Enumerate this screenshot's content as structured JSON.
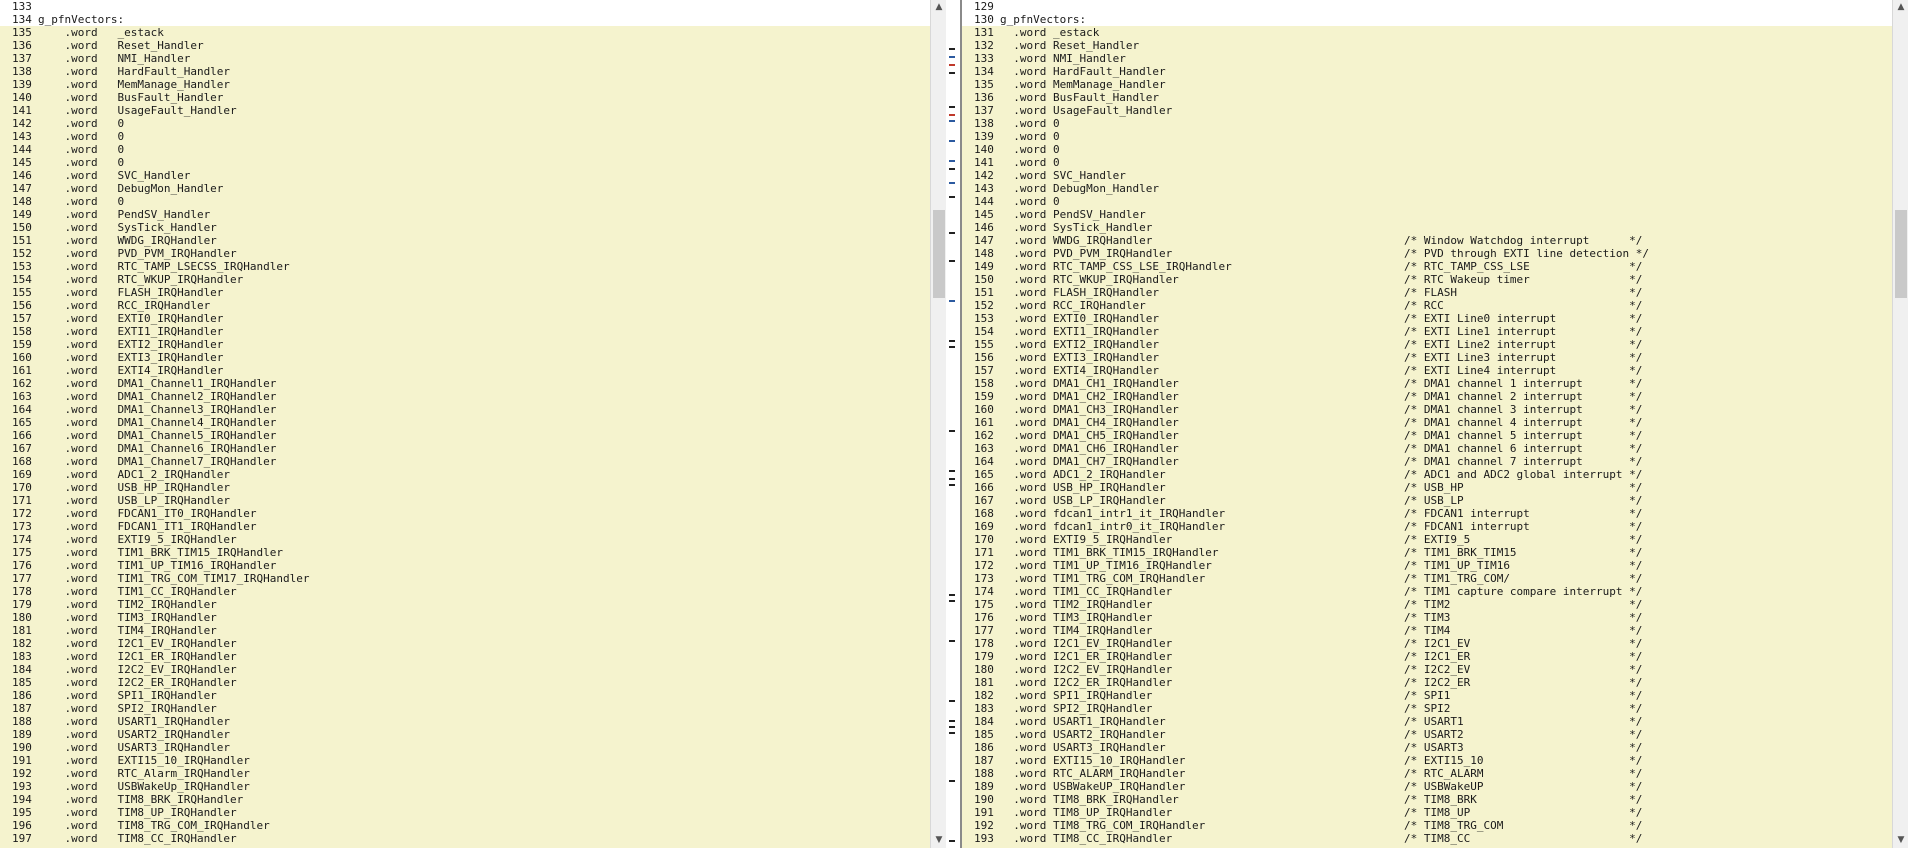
{
  "left": {
    "lines": [
      {
        "n": "133",
        "t": ""
      },
      {
        "n": "134",
        "t": "g_pfnVectors:"
      },
      {
        "n": "135",
        "t": "    .word   _estack"
      },
      {
        "n": "136",
        "t": "    .word   Reset_Handler"
      },
      {
        "n": "137",
        "t": "    .word   NMI_Handler"
      },
      {
        "n": "138",
        "t": "    .word   HardFault_Handler"
      },
      {
        "n": "139",
        "t": "    .word   MemManage_Handler"
      },
      {
        "n": "140",
        "t": "    .word   BusFault_Handler"
      },
      {
        "n": "141",
        "t": "    .word   UsageFault_Handler"
      },
      {
        "n": "142",
        "t": "    .word   0"
      },
      {
        "n": "143",
        "t": "    .word   0"
      },
      {
        "n": "144",
        "t": "    .word   0"
      },
      {
        "n": "145",
        "t": "    .word   0"
      },
      {
        "n": "146",
        "t": "    .word   SVC_Handler"
      },
      {
        "n": "147",
        "t": "    .word   DebugMon_Handler"
      },
      {
        "n": "148",
        "t": "    .word   0"
      },
      {
        "n": "149",
        "t": "    .word   PendSV_Handler"
      },
      {
        "n": "150",
        "t": "    .word   SysTick_Handler"
      },
      {
        "n": "151",
        "t": "    .word   WWDG_IRQHandler"
      },
      {
        "n": "152",
        "t": "    .word   PVD_PVM_IRQHandler"
      },
      {
        "n": "153",
        "t": "    .word   RTC_TAMP_LSECSS_IRQHandler"
      },
      {
        "n": "154",
        "t": "    .word   RTC_WKUP_IRQHandler"
      },
      {
        "n": "155",
        "t": "    .word   FLASH_IRQHandler"
      },
      {
        "n": "156",
        "t": "    .word   RCC_IRQHandler"
      },
      {
        "n": "157",
        "t": "    .word   EXTI0_IRQHandler"
      },
      {
        "n": "158",
        "t": "    .word   EXTI1_IRQHandler"
      },
      {
        "n": "159",
        "t": "    .word   EXTI2_IRQHandler"
      },
      {
        "n": "160",
        "t": "    .word   EXTI3_IRQHandler"
      },
      {
        "n": "161",
        "t": "    .word   EXTI4_IRQHandler"
      },
      {
        "n": "162",
        "t": "    .word   DMA1_Channel1_IRQHandler"
      },
      {
        "n": "163",
        "t": "    .word   DMA1_Channel2_IRQHandler"
      },
      {
        "n": "164",
        "t": "    .word   DMA1_Channel3_IRQHandler"
      },
      {
        "n": "165",
        "t": "    .word   DMA1_Channel4_IRQHandler"
      },
      {
        "n": "166",
        "t": "    .word   DMA1_Channel5_IRQHandler"
      },
      {
        "n": "167",
        "t": "    .word   DMA1_Channel6_IRQHandler"
      },
      {
        "n": "168",
        "t": "    .word   DMA1_Channel7_IRQHandler"
      },
      {
        "n": "169",
        "t": "    .word   ADC1_2_IRQHandler"
      },
      {
        "n": "170",
        "t": "    .word   USB_HP_IRQHandler"
      },
      {
        "n": "171",
        "t": "    .word   USB_LP_IRQHandler"
      },
      {
        "n": "172",
        "t": "    .word   FDCAN1_IT0_IRQHandler"
      },
      {
        "n": "173",
        "t": "    .word   FDCAN1_IT1_IRQHandler"
      },
      {
        "n": "174",
        "t": "    .word   EXTI9_5_IRQHandler"
      },
      {
        "n": "175",
        "t": "    .word   TIM1_BRK_TIM15_IRQHandler"
      },
      {
        "n": "176",
        "t": "    .word   TIM1_UP_TIM16_IRQHandler"
      },
      {
        "n": "177",
        "t": "    .word   TIM1_TRG_COM_TIM17_IRQHandler"
      },
      {
        "n": "178",
        "t": "    .word   TIM1_CC_IRQHandler"
      },
      {
        "n": "179",
        "t": "    .word   TIM2_IRQHandler"
      },
      {
        "n": "180",
        "t": "    .word   TIM3_IRQHandler"
      },
      {
        "n": "181",
        "t": "    .word   TIM4_IRQHandler"
      },
      {
        "n": "182",
        "t": "    .word   I2C1_EV_IRQHandler"
      },
      {
        "n": "183",
        "t": "    .word   I2C1_ER_IRQHandler"
      },
      {
        "n": "184",
        "t": "    .word   I2C2_EV_IRQHandler"
      },
      {
        "n": "185",
        "t": "    .word   I2C2_ER_IRQHandler"
      },
      {
        "n": "186",
        "t": "    .word   SPI1_IRQHandler"
      },
      {
        "n": "187",
        "t": "    .word   SPI2_IRQHandler"
      },
      {
        "n": "188",
        "t": "    .word   USART1_IRQHandler"
      },
      {
        "n": "189",
        "t": "    .word   USART2_IRQHandler"
      },
      {
        "n": "190",
        "t": "    .word   USART3_IRQHandler"
      },
      {
        "n": "191",
        "t": "    .word   EXTI15_10_IRQHandler"
      },
      {
        "n": "192",
        "t": "    .word   RTC_Alarm_IRQHandler"
      },
      {
        "n": "193",
        "t": "    .word   USBWakeUp_IRQHandler"
      },
      {
        "n": "194",
        "t": "    .word   TIM8_BRK_IRQHandler"
      },
      {
        "n": "195",
        "t": "    .word   TIM8_UP_IRQHandler"
      },
      {
        "n": "196",
        "t": "    .word   TIM8_TRG_COM_IRQHandler"
      },
      {
        "n": "197",
        "t": "    .word   TIM8_CC_IRQHandler"
      }
    ]
  },
  "right": {
    "lines": [
      {
        "n": "129",
        "t": ""
      },
      {
        "n": "130",
        "t": "g_pfnVectors:"
      },
      {
        "n": "131",
        "t": "  .word _estack"
      },
      {
        "n": "132",
        "t": "  .word Reset_Handler"
      },
      {
        "n": "133",
        "t": "  .word NMI_Handler"
      },
      {
        "n": "134",
        "t": "  .word HardFault_Handler"
      },
      {
        "n": "135",
        "t": "  .word MemManage_Handler"
      },
      {
        "n": "136",
        "t": "  .word BusFault_Handler"
      },
      {
        "n": "137",
        "t": "  .word UsageFault_Handler"
      },
      {
        "n": "138",
        "t": "  .word 0"
      },
      {
        "n": "139",
        "t": "  .word 0"
      },
      {
        "n": "140",
        "t": "  .word 0"
      },
      {
        "n": "141",
        "t": "  .word 0"
      },
      {
        "n": "142",
        "t": "  .word SVC_Handler"
      },
      {
        "n": "143",
        "t": "  .word DebugMon_Handler"
      },
      {
        "n": "144",
        "t": "  .word 0"
      },
      {
        "n": "145",
        "t": "  .word PendSV_Handler"
      },
      {
        "n": "146",
        "t": "  .word SysTick_Handler"
      },
      {
        "n": "147",
        "t": "  .word WWDG_IRQHandler                                      /* Window Watchdog interrupt      */"
      },
      {
        "n": "148",
        "t": "  .word PVD_PVM_IRQHandler                                   /* PVD through EXTI line detection */"
      },
      {
        "n": "149",
        "t": "  .word RTC_TAMP_CSS_LSE_IRQHandler                          /* RTC_TAMP_CSS_LSE               */"
      },
      {
        "n": "150",
        "t": "  .word RTC_WKUP_IRQHandler                                  /* RTC Wakeup timer               */"
      },
      {
        "n": "151",
        "t": "  .word FLASH_IRQHandler                                     /* FLASH                          */"
      },
      {
        "n": "152",
        "t": "  .word RCC_IRQHandler                                       /* RCC                            */"
      },
      {
        "n": "153",
        "t": "  .word EXTI0_IRQHandler                                     /* EXTI Line0 interrupt           */"
      },
      {
        "n": "154",
        "t": "  .word EXTI1_IRQHandler                                     /* EXTI Line1 interrupt           */"
      },
      {
        "n": "155",
        "t": "  .word EXTI2_IRQHandler                                     /* EXTI Line2 interrupt           */"
      },
      {
        "n": "156",
        "t": "  .word EXTI3_IRQHandler                                     /* EXTI Line3 interrupt           */"
      },
      {
        "n": "157",
        "t": "  .word EXTI4_IRQHandler                                     /* EXTI Line4 interrupt           */"
      },
      {
        "n": "158",
        "t": "  .word DMA1_CH1_IRQHandler                                  /* DMA1 channel 1 interrupt       */"
      },
      {
        "n": "159",
        "t": "  .word DMA1_CH2_IRQHandler                                  /* DMA1 channel 2 interrupt       */"
      },
      {
        "n": "160",
        "t": "  .word DMA1_CH3_IRQHandler                                  /* DMA1 channel 3 interrupt       */"
      },
      {
        "n": "161",
        "t": "  .word DMA1_CH4_IRQHandler                                  /* DMA1 channel 4 interrupt       */"
      },
      {
        "n": "162",
        "t": "  .word DMA1_CH5_IRQHandler                                  /* DMA1 channel 5 interrupt       */"
      },
      {
        "n": "163",
        "t": "  .word DMA1_CH6_IRQHandler                                  /* DMA1 channel 6 interrupt       */"
      },
      {
        "n": "164",
        "t": "  .word DMA1_CH7_IRQHandler                                  /* DMA1 channel 7 interrupt       */"
      },
      {
        "n": "165",
        "t": "  .word ADC1_2_IRQHandler                                    /* ADC1 and ADC2 global interrupt */"
      },
      {
        "n": "166",
        "t": "  .word USB_HP_IRQHandler                                    /* USB_HP                         */"
      },
      {
        "n": "167",
        "t": "  .word USB_LP_IRQHandler                                    /* USB_LP                         */"
      },
      {
        "n": "168",
        "t": "  .word fdcan1_intr1_it_IRQHandler                           /* FDCAN1 interrupt               */"
      },
      {
        "n": "169",
        "t": "  .word fdcan1_intr0_it_IRQHandler                           /* FDCAN1 interrupt               */"
      },
      {
        "n": "170",
        "t": "  .word EXTI9_5_IRQHandler                                   /* EXTI9_5                        */"
      },
      {
        "n": "171",
        "t": "  .word TIM1_BRK_TIM15_IRQHandler                            /* TIM1_BRK_TIM15                 */"
      },
      {
        "n": "172",
        "t": "  .word TIM1_UP_TIM16_IRQHandler                             /* TIM1_UP_TIM16                  */"
      },
      {
        "n": "173",
        "t": "  .word TIM1_TRG_COM_IRQHandler                              /* TIM1_TRG_COM/                  */"
      },
      {
        "n": "174",
        "t": "  .word TIM1_CC_IRQHandler                                   /* TIM1 capture compare interrupt */"
      },
      {
        "n": "175",
        "t": "  .word TIM2_IRQHandler                                      /* TIM2                           */"
      },
      {
        "n": "176",
        "t": "  .word TIM3_IRQHandler                                      /* TIM3                           */"
      },
      {
        "n": "177",
        "t": "  .word TIM4_IRQHandler                                      /* TIM4                           */"
      },
      {
        "n": "178",
        "t": "  .word I2C1_EV_IRQHandler                                   /* I2C1_EV                        */"
      },
      {
        "n": "179",
        "t": "  .word I2C1_ER_IRQHandler                                   /* I2C1_ER                        */"
      },
      {
        "n": "180",
        "t": "  .word I2C2_EV_IRQHandler                                   /* I2C2_EV                        */"
      },
      {
        "n": "181",
        "t": "  .word I2C2_ER_IRQHandler                                   /* I2C2_ER                        */"
      },
      {
        "n": "182",
        "t": "  .word SPI1_IRQHandler                                      /* SPI1                           */"
      },
      {
        "n": "183",
        "t": "  .word SPI2_IRQHandler                                      /* SPI2                           */"
      },
      {
        "n": "184",
        "t": "  .word USART1_IRQHandler                                    /* USART1                         */"
      },
      {
        "n": "185",
        "t": "  .word USART2_IRQHandler                                    /* USART2                         */"
      },
      {
        "n": "186",
        "t": "  .word USART3_IRQHandler                                    /* USART3                         */"
      },
      {
        "n": "187",
        "t": "  .word EXTI15_10_IRQHandler                                 /* EXTI15_10                      */"
      },
      {
        "n": "188",
        "t": "  .word RTC_ALARM_IRQHandler                                 /* RTC_ALARM                      */"
      },
      {
        "n": "189",
        "t": "  .word USBWakeUP_IRQHandler                                 /* USBWakeUP                      */"
      },
      {
        "n": "190",
        "t": "  .word TIM8_BRK_IRQHandler                                  /* TIM8_BRK                       */"
      },
      {
        "n": "191",
        "t": "  .word TIM8_UP_IRQHandler                                   /* TIM8_UP                        */"
      },
      {
        "n": "192",
        "t": "  .word TIM8_TRG_COM_IRQHandler                              /* TIM8_TRG_COM                   */"
      },
      {
        "n": "193",
        "t": "  .word TIM8_CC_IRQHandler                                   /* TIM8_CC                        */"
      }
    ]
  },
  "icons": {
    "scroll_up": "▲",
    "scroll_down": "▼"
  },
  "colors": {
    "diff_background": "#f5f3ce",
    "overview_marker_red": "#c0392b",
    "overview_marker_blue": "#2c5aa0",
    "overview_marker_black": "#222222"
  }
}
